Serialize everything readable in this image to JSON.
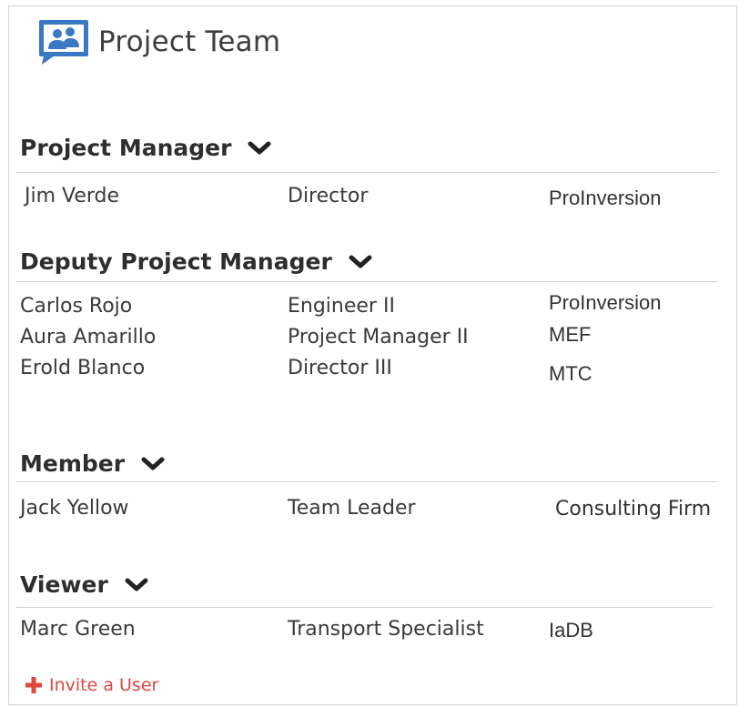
{
  "app": {
    "title": "Project Team"
  },
  "colors": {
    "accent": "#3a78c4",
    "invite": "#e0463a",
    "divider": "#cfcfcf",
    "text": "#333333"
  },
  "icons": {
    "header": "people-chat-icon",
    "collapse": "chevron-down-icon",
    "invite": "plus-icon"
  },
  "sections": {
    "project_manager": {
      "heading": "Project Manager",
      "rows": [
        {
          "name": "Jim Verde",
          "role": "Director",
          "org": "ProInversion"
        }
      ]
    },
    "deputy_project_manager": {
      "heading": "Deputy Project Manager",
      "rows": [
        {
          "name": "Carlos Rojo",
          "role": "Engineer II",
          "org": "ProInversion"
        },
        {
          "name": "Aura Amarillo",
          "role": "Project Manager II",
          "org": "MEF"
        },
        {
          "name": "Erold Blanco",
          "role": "Director III",
          "org": "MTC"
        }
      ]
    },
    "member": {
      "heading": "Member",
      "rows": [
        {
          "name": "Jack Yellow",
          "role": "Team Leader",
          "org": "Consulting Firm"
        }
      ]
    },
    "viewer": {
      "heading": "Viewer",
      "rows": [
        {
          "name": "Marc Green",
          "role": "Transport Specialist",
          "org": "IaDB"
        }
      ]
    }
  },
  "actions": {
    "invite_label": "Invite a User"
  }
}
